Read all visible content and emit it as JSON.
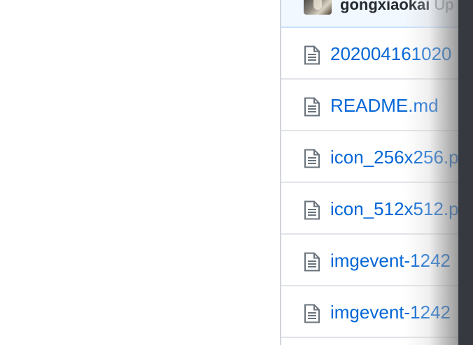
{
  "commit_row": {
    "author": "gongxiaokai",
    "message": "Up"
  },
  "files": [
    {
      "name": "202004161020",
      "icon": "file-text-icon"
    },
    {
      "name": "README.md",
      "icon": "file-text-icon"
    },
    {
      "name": "icon_256x256.p",
      "icon": "file-text-icon"
    },
    {
      "name": "icon_512x512.p",
      "icon": "file-text-icon"
    },
    {
      "name": "imgevent-1242",
      "icon": "file-text-icon"
    },
    {
      "name": "imgevent-1242",
      "icon": "file-text-icon"
    }
  ],
  "colors": {
    "link": "#0366d6",
    "commit_background": "#f1f8ff",
    "border": "#e1e4e8",
    "dark_edge": "#363a40"
  }
}
